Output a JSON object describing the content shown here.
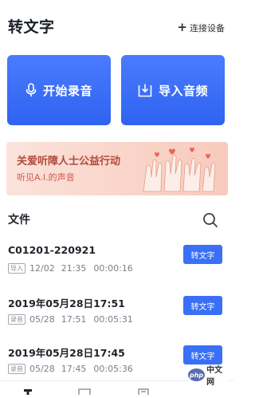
{
  "header": {
    "title": "转文字",
    "connect_label": "连接设备"
  },
  "actions": {
    "record_label": "开始录音",
    "import_label": "导入音频"
  },
  "banner": {
    "title": "关爱听障人士公益行动",
    "subtitle": "听见A.I.的声音"
  },
  "files": {
    "title": "文件",
    "items": [
      {
        "name": "C01201-220921",
        "tag": "导入",
        "date": "12/02",
        "time": "21:35",
        "duration": "00:00:16",
        "button": "转文字"
      },
      {
        "name": "2019年05月28日17:51",
        "tag": "录音",
        "date": "05/28",
        "time": "17:51",
        "duration": "00:05:31",
        "button": "转文字"
      },
      {
        "name": "2019年05月28日17:45",
        "tag": "录音",
        "date": "05/28",
        "time": "17:45",
        "duration": "00:05:36",
        "button": "转文字"
      }
    ]
  },
  "watermark": {
    "logo": "php",
    "text": "中文网"
  },
  "colors": {
    "primary": "#3a70f5",
    "banner_text": "#b34a3a"
  }
}
